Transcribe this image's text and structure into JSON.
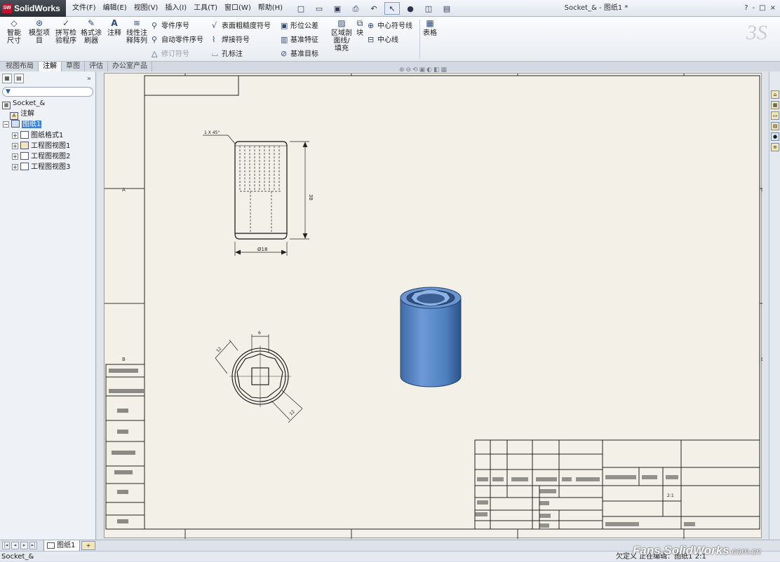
{
  "app": {
    "name": "SolidWorks",
    "mark": "SW"
  },
  "menu": [
    "文件(F)",
    "编辑(E)",
    "视图(V)",
    "插入(I)",
    "工具(T)",
    "窗口(W)",
    "帮助(H)"
  ],
  "document_title": "Socket_& - 图纸1 *",
  "window_controls": [
    "?",
    "-",
    "□",
    "×"
  ],
  "command_manager": {
    "smart_dim": "智能尺寸",
    "model_items": "模型项目",
    "spell_check": "拼写检验程序",
    "format_painter": "格式涂刷器",
    "note": "注释",
    "linear_note_pattern": "线性注释阵列",
    "balloon": "零件序号",
    "auto_balloon": "自动零件序号",
    "revision_symbol": "修订符号",
    "surface_finish": "表面粗糙度符号",
    "weld_symbol": "焊接符号",
    "hole_callout": "孔标注",
    "gtol": "形位公差",
    "datum_feature": "基准特征",
    "datum_target": "基准目标",
    "area_hatch": "区域剖面线/填充",
    "block": "块",
    "center_mark": "中心符号线",
    "centerline": "中心线",
    "tables": "表格"
  },
  "tabs": [
    "视图布局",
    "注解",
    "草图",
    "评估",
    "办公室产品"
  ],
  "active_tab": "注解",
  "tree": {
    "root": "Socket_&",
    "annotations": "注解",
    "sheet": "图纸1",
    "sheet_format": "图纸格式1",
    "views": [
      "工程图视图1",
      "工程图视图2",
      "工程图视图3"
    ]
  },
  "drawing": {
    "chamfer_label": "1 X 45°",
    "dia_label": "Ø18",
    "height_label": "38",
    "top_dim": "6",
    "radial_dim_1": "12",
    "radial_dim_2": "12",
    "scale_label": "2:1",
    "border_letters_left": [
      "A",
      "B"
    ],
    "border_letters_right": [
      "C",
      "D"
    ]
  },
  "sheet_tabs": {
    "active": "图纸1"
  },
  "status": {
    "left": "Socket_&",
    "right": "欠定义   正在编辑：图纸1   2:1"
  },
  "watermark": {
    "brand": "Fans.SolidWorks",
    "domain": ".com.cn"
  },
  "colors": {
    "part_body": "#4e7fbf",
    "sheet_bg": "#f3f1e7",
    "selection": "#3f7fd6"
  }
}
